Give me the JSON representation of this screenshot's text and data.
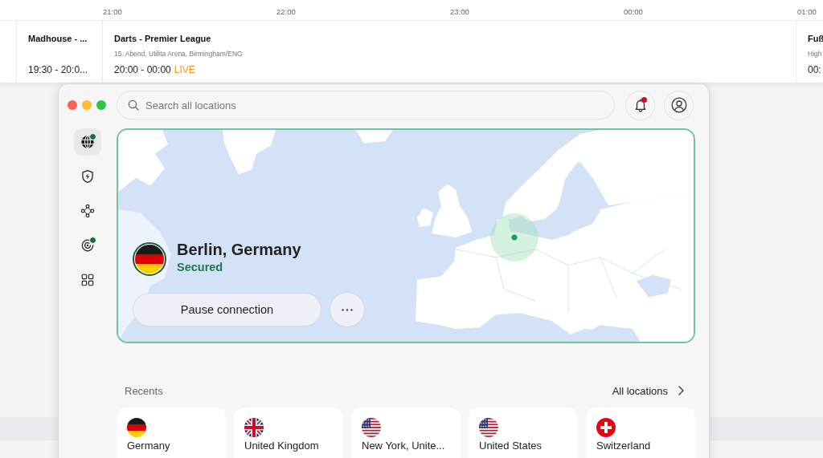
{
  "tv_guide": {
    "times": [
      "21:00",
      "22:00",
      "23:00",
      "00:00",
      "01:00"
    ],
    "programmes": [
      {
        "title": "Madhouse - ...",
        "time": "19:30 - 20:0..."
      },
      {
        "title": "Darts - Premier League",
        "subtitle": "15. Abend, Utilita Arena, Birmingham/ENG",
        "time": "20:00 - 00:00",
        "badge": "LIVE"
      },
      {
        "title": "Fuß",
        "subtitle": "High",
        "time": "00:"
      }
    ]
  },
  "window": {
    "search": {
      "placeholder": "Search all locations"
    },
    "notifications": {
      "unread": true
    },
    "sidebar": {
      "items": [
        {
          "selected": true,
          "dot": true
        },
        {
          "selected": false,
          "dot": false
        },
        {
          "selected": false,
          "dot": false
        },
        {
          "selected": false,
          "dot": true
        },
        {
          "selected": false,
          "dot": false
        }
      ]
    },
    "connection": {
      "location": "Berlin, Germany",
      "status": "Secured",
      "secured": true,
      "button": "Pause connection"
    },
    "recents": {
      "title": "Recents",
      "link": "All locations",
      "items": [
        {
          "name": "Germany"
        },
        {
          "name": "United Kingdom"
        },
        {
          "name": "New York, Unite..."
        },
        {
          "name": "United States"
        },
        {
          "name": "Switzerland"
        }
      ]
    }
  }
}
